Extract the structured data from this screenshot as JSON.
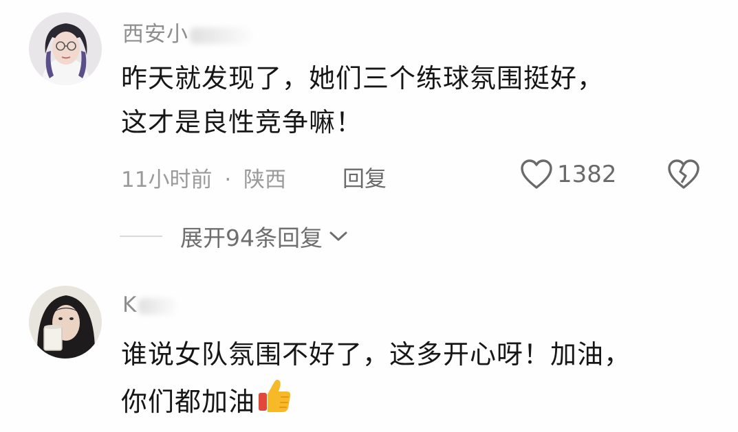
{
  "comments": [
    {
      "username": "西安小",
      "text_lines": [
        "昨天就发现了，她们三个练球氛围挺好，",
        "这才是良性竞争嘛！"
      ],
      "time": "11小时前",
      "separator": "·",
      "location": "陕西",
      "reply_label": "回复",
      "like_count": "1382",
      "expand_label": "展开94条回复"
    },
    {
      "username": "K",
      "text_lines": [
        "谁说女队氛围不好了，这多开心呀！加油，",
        "你们都加油"
      ],
      "emoji": "thumbs-up"
    }
  ],
  "icons": {
    "like": "heart-outline-icon",
    "dislike": "broken-heart-icon",
    "expand": "chevron-down-icon"
  },
  "colors": {
    "text": "#161616",
    "secondary": "#9a9a9a",
    "icon": "#6a6a6a",
    "thumb": "#f7b928"
  }
}
